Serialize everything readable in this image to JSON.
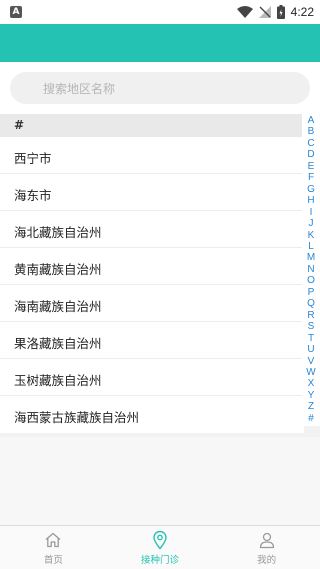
{
  "status_bar": {
    "time": "4:22",
    "app_badge": "A"
  },
  "search": {
    "placeholder": "搜索地区名称"
  },
  "section": {
    "label": "#"
  },
  "regions": [
    "西宁市",
    "海东市",
    "海北藏族自治州",
    "黄南藏族自治州",
    "海南藏族自治州",
    "果洛藏族自治州",
    "玉树藏族自治州",
    "海西蒙古族藏族自治州"
  ],
  "index_letters": [
    "A",
    "B",
    "C",
    "D",
    "E",
    "F",
    "G",
    "H",
    "I",
    "J",
    "K",
    "L",
    "M",
    "N",
    "O",
    "P",
    "Q",
    "R",
    "S",
    "T",
    "U",
    "V",
    "W",
    "X",
    "Y",
    "Z",
    "#"
  ],
  "tabs": [
    {
      "label": "首页",
      "icon": "home-icon"
    },
    {
      "label": "接种门诊",
      "icon": "location-pin-icon"
    },
    {
      "label": "我的",
      "icon": "user-icon"
    }
  ],
  "colors": {
    "accent": "#23c2b3",
    "index_letter": "#2a86d4"
  }
}
